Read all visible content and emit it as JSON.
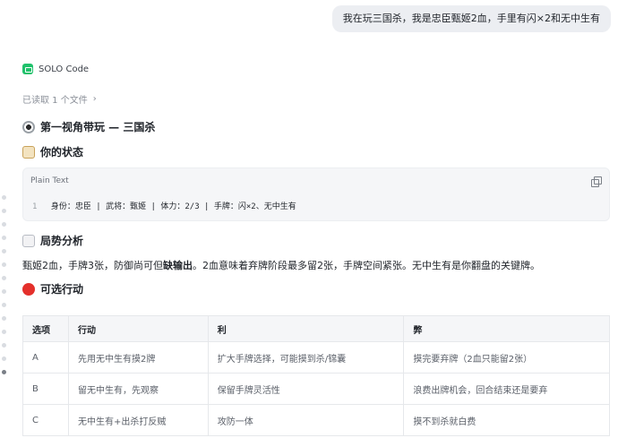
{
  "user_message": "我在玩三国杀，我是忠臣甄姬2血，手里有闪×2和无中生有",
  "assistant": {
    "name": "SOLO Code",
    "read_files_label": "已读取 1 个文件",
    "chevron": "›"
  },
  "headings": {
    "first_person": "第一视角带玩 — 三国杀",
    "your_status": "你的状态",
    "situation": "局势分析",
    "options": "可选行动"
  },
  "code_block": {
    "language": "Plain Text",
    "line_number": "1",
    "line_text": "身份：忠臣 | 武将：甄姬 | 体力：2/3 | 手牌：闪×2、无中生有"
  },
  "analysis": {
    "part1": "甄姬2血，手牌3张，防御尚可但",
    "bold": "缺输出",
    "part2": "。2血意味着弃牌阶段最多留2张，手牌空间紧张。无中生有是你翻盘的关键牌。"
  },
  "table": {
    "headers": [
      "选项",
      "行动",
      "利",
      "弊"
    ],
    "rows": [
      [
        "A",
        "先用无中生有摸2牌",
        "扩大手牌选择，可能摸到杀/锦囊",
        "摸完要弃牌（2血只能留2张）"
      ],
      [
        "B",
        "留无中生有，先观察",
        "保留手牌灵活性",
        "浪费出牌机会，回合结束还是要弃"
      ],
      [
        "C",
        "无中生有+出杀打反贼",
        "攻防一体",
        "摸不到杀就白费"
      ]
    ]
  }
}
